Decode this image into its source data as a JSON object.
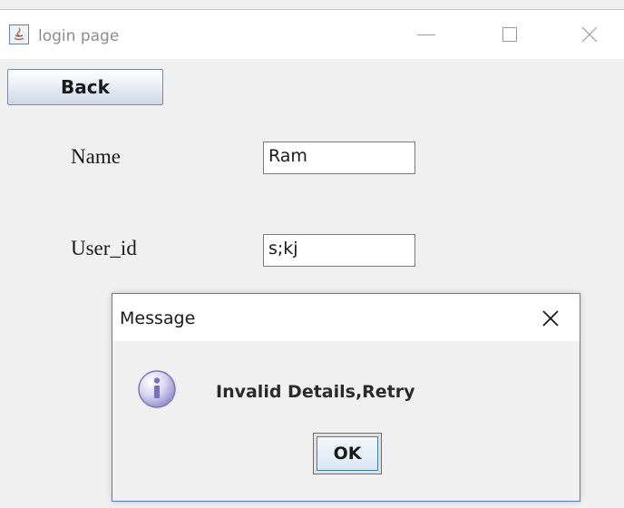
{
  "window": {
    "title": "login page",
    "app_icon": "java-coffee-icon",
    "controls": [
      "minimize-icon",
      "maximize-icon",
      "close-icon"
    ]
  },
  "form": {
    "back_label": "Back",
    "name_label": "Name",
    "name_value": "Ram",
    "userid_label": "User_id",
    "userid_value": "s;kj"
  },
  "dialog": {
    "title": "Message",
    "icon": "info-icon",
    "message": "Invalid Details,Retry",
    "ok_label": "OK"
  },
  "colors": {
    "window_bg": "#f0f0f0",
    "dialog_border": "#4f7fbf",
    "info_icon": "#8f86c9"
  }
}
